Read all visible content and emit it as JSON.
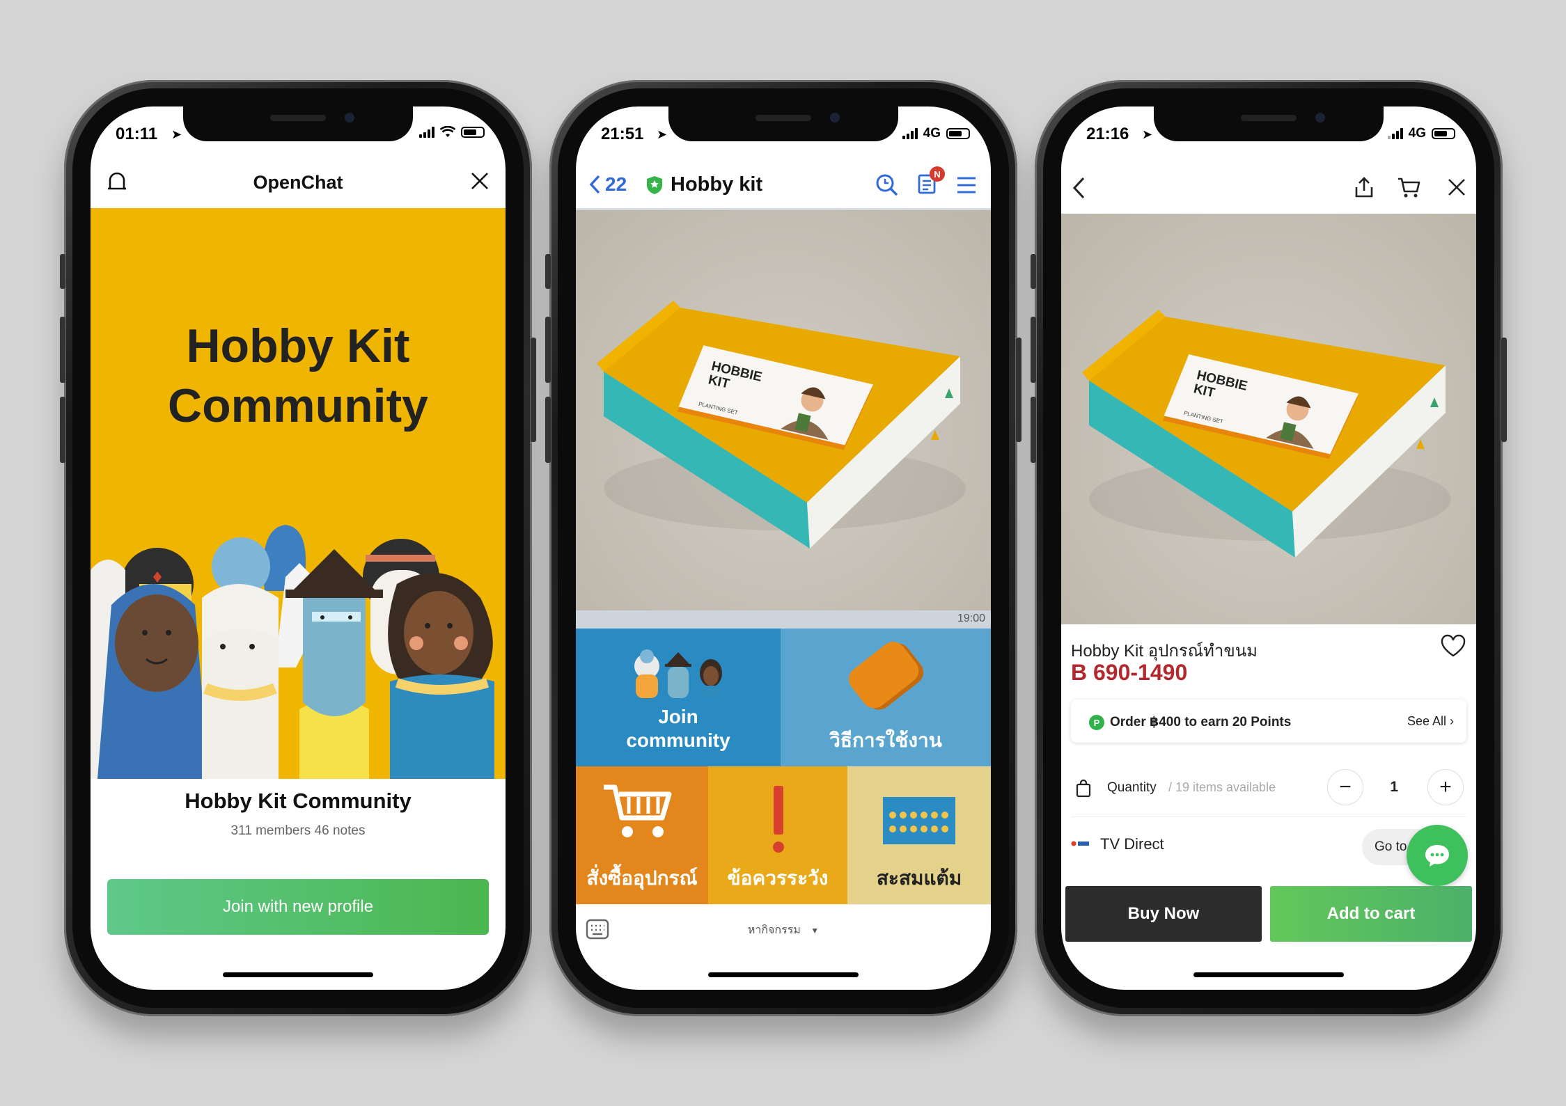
{
  "phone1": {
    "status": {
      "time": "01:11"
    },
    "header": {
      "title": "OpenChat"
    },
    "hero": {
      "title_line1": "Hobby Kit",
      "title_line2": "Community"
    },
    "community_name": "Hobby Kit Community",
    "stats": "311 members 46 notes",
    "join_button": "Join with new profile"
  },
  "phone2": {
    "status": {
      "time": "21:51",
      "network": "4G"
    },
    "header": {
      "back_count": "22",
      "title": "Hobby kit",
      "badge": "N"
    },
    "box_label": {
      "line1": "HOBBIE",
      "line2": "KIT",
      "sub": "PLANTING SET"
    },
    "message_time": "19:00",
    "menu": {
      "join": {
        "line1": "Join",
        "line2": "community"
      },
      "howto": "วิธีการใช้งาน",
      "order": "สั่งซื้ออุปกรณ์",
      "caution": "ข้อควรระวัง",
      "points": "สะสมแต้ม"
    },
    "bottom": {
      "activity": "หากิจกรรม"
    }
  },
  "phone3": {
    "status": {
      "time": "21:16",
      "network": "4G"
    },
    "box_label": {
      "line1": "HOBBIE",
      "line2": "KIT",
      "sub": "PLANTING SET"
    },
    "product": {
      "name": "Hobby Kit อุปกรณ์ทำขนม",
      "price": "B 690-1490"
    },
    "points": {
      "badge": "P",
      "text": "Order ฿400 to earn 20 Points",
      "see_all": "See All"
    },
    "quantity": {
      "label": "Quantity",
      "available": "/ 19 items available",
      "value": "1",
      "minus": "−",
      "plus": "+"
    },
    "shop": {
      "name": "TV Direct",
      "goto": "Go to"
    },
    "actions": {
      "buy_now": "Buy Now",
      "add_to_cart": "Add to cart"
    }
  },
  "colors": {
    "background": "#d4d4d4",
    "hero_yellow": "#efb500",
    "line_green": "#4bb74f",
    "link_blue": "#2f6ad8",
    "price_red": "#b3282d",
    "box_teal": "#33b8b8"
  }
}
